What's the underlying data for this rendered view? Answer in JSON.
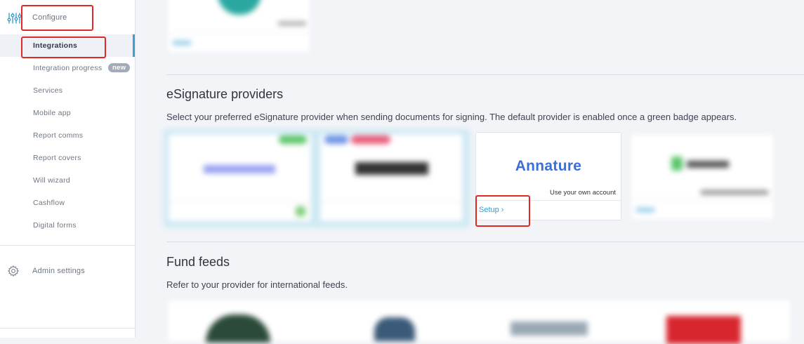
{
  "sidebar": {
    "configure_label": "Configure",
    "items": [
      {
        "label": "Integrations",
        "active": true
      },
      {
        "label": "Integration progress",
        "badge": "new"
      },
      {
        "label": "Services"
      },
      {
        "label": "Mobile app"
      },
      {
        "label": "Report comms"
      },
      {
        "label": "Report covers"
      },
      {
        "label": "Will wizard"
      },
      {
        "label": "Cashflow"
      },
      {
        "label": "Digital forms"
      }
    ],
    "admin_label": "Admin settings"
  },
  "esignature": {
    "title": "eSignature providers",
    "description": "Select your preferred eSignature provider when sending documents for signing. The default provider is enabled once a green badge appears.",
    "annature_card": {
      "logo_text": "Annature",
      "account_note": "Use your own account",
      "setup_link": "Setup ›"
    }
  },
  "fund_feeds": {
    "title": "Fund feeds",
    "description": "Refer to your provider for international feeds."
  },
  "colors": {
    "accent": "#2d9fd2",
    "annature_brand": "#3b6fd8",
    "highlight": "#e02828",
    "active_border": "#3aa0d0"
  }
}
